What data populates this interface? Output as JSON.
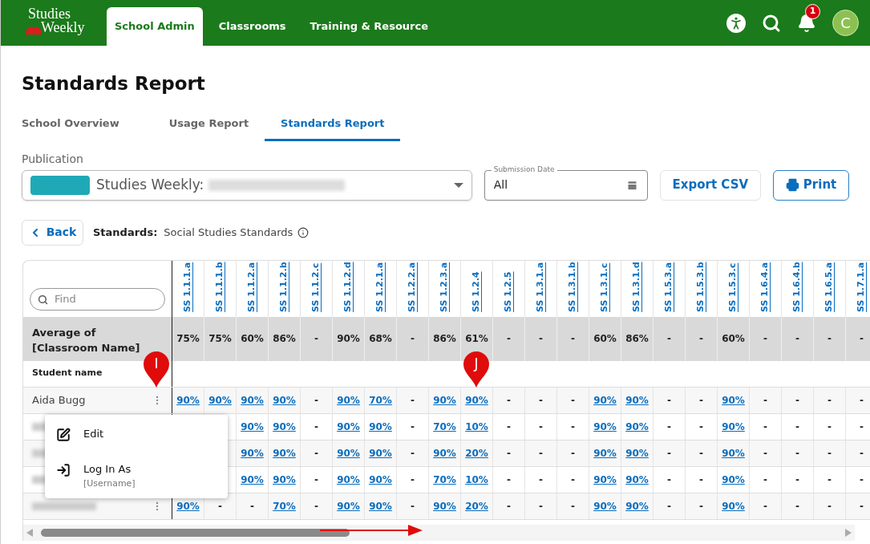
{
  "nav": {
    "logo": [
      "Studies",
      "Weekly"
    ],
    "tabs": [
      {
        "label": "School Admin",
        "selected": true
      },
      {
        "label": "Classrooms",
        "selected": false
      },
      {
        "label": "Training & Resource",
        "selected": false
      }
    ],
    "notification_count": "1",
    "avatar": "C"
  },
  "title": "Standards Report",
  "subtabs": [
    {
      "label": "School Overview",
      "selected": false
    },
    {
      "label": "Usage Report",
      "selected": false
    },
    {
      "label": "Standards Report",
      "selected": true
    }
  ],
  "publication": {
    "label": "Publication",
    "value": "Studies Weekly:"
  },
  "submission_date": {
    "label": "Submission Date",
    "value": "All"
  },
  "buttons": {
    "export": "Export CSV",
    "print": "Print",
    "back": "Back"
  },
  "standards": {
    "label": "Standards:",
    "value": "Social Studies Standards"
  },
  "table": {
    "find_placeholder": "Find",
    "average_label": "Average of [Classroom Name]",
    "student_header": "Student name",
    "columns": [
      "SS 1.1.1.a",
      "SS 1.1.1.b",
      "SS 1.1.2.a",
      "SS 1.1.2.b",
      "SS 1.1.2.c",
      "SS 1.1.2.d",
      "SS 1.2.1.a",
      "SS 1.2.2.a",
      "SS 1.2.3.a",
      "SS 1.2.4",
      "SS 1.2.5",
      "SS 1.3.1.a",
      "SS 1.3.1.b",
      "SS 1.3.1.c",
      "SS 1.3.1.d",
      "SS 1.5.3.a",
      "SS 1.5.3.b",
      "SS 1.5.3.c",
      "SS 1.6.4.a",
      "SS 1.6.4.b",
      "SS 1.6.5.a",
      "SS 1.7.1.a"
    ],
    "averages": [
      "75%",
      "75%",
      "60%",
      "86%",
      "-",
      "90%",
      "68%",
      "-",
      "86%",
      "61%",
      "-",
      "-",
      "-",
      "60%",
      "86%",
      "-",
      "-",
      "60%",
      "-",
      "-",
      "-",
      "-"
    ],
    "rows": [
      {
        "name": "Aida Bugg",
        "cells": [
          {
            "text": "90%",
            "link": true
          },
          {
            "text": "90%",
            "link": true
          },
          {
            "text": "90%",
            "link": true
          },
          {
            "text": "90%",
            "link": true
          },
          {
            "text": "-",
            "link": false
          },
          {
            "text": "90%",
            "link": true
          },
          {
            "text": "70%",
            "link": true
          },
          {
            "text": "-",
            "link": false
          },
          {
            "text": "90%",
            "link": true
          },
          {
            "text": "90%",
            "link": true
          },
          {
            "text": "-",
            "link": false
          },
          {
            "text": "-",
            "link": false
          },
          {
            "text": "-",
            "link": false
          },
          {
            "text": "90%",
            "link": true
          },
          {
            "text": "90%",
            "link": true
          },
          {
            "text": "-",
            "link": false
          },
          {
            "text": "-",
            "link": false
          },
          {
            "text": "90%",
            "link": true
          },
          {
            "text": "-",
            "link": false
          },
          {
            "text": "-",
            "link": false
          },
          {
            "text": "-",
            "link": false
          },
          {
            "text": "-",
            "link": false
          }
        ]
      },
      {
        "cells": [
          null,
          null,
          {
            "text": "90%",
            "link": true
          },
          {
            "text": "90%",
            "link": true
          },
          {
            "text": "-",
            "link": false
          },
          {
            "text": "90%",
            "link": true
          },
          {
            "text": "90%",
            "link": true
          },
          {
            "text": "-",
            "link": false
          },
          {
            "text": "70%",
            "link": true
          },
          {
            "text": "10%",
            "link": true
          },
          {
            "text": "-",
            "link": false
          },
          {
            "text": "-",
            "link": false
          },
          {
            "text": "-",
            "link": false
          },
          {
            "text": "90%",
            "link": true
          },
          {
            "text": "90%",
            "link": true
          },
          {
            "text": "-",
            "link": false
          },
          {
            "text": "-",
            "link": false
          },
          {
            "text": "90%",
            "link": true
          },
          {
            "text": "-",
            "link": false
          },
          {
            "text": "-",
            "link": false
          },
          {
            "text": "-",
            "link": false
          },
          {
            "text": "-",
            "link": false
          }
        ]
      },
      {
        "cells": [
          null,
          null,
          {
            "text": "90%",
            "link": true
          },
          {
            "text": "90%",
            "link": true
          },
          {
            "text": "-",
            "link": false
          },
          {
            "text": "90%",
            "link": true
          },
          {
            "text": "90%",
            "link": true
          },
          {
            "text": "-",
            "link": false
          },
          {
            "text": "90%",
            "link": true
          },
          {
            "text": "20%",
            "link": true
          },
          {
            "text": "-",
            "link": false
          },
          {
            "text": "-",
            "link": false
          },
          {
            "text": "-",
            "link": false
          },
          {
            "text": "90%",
            "link": true
          },
          {
            "text": "90%",
            "link": true
          },
          {
            "text": "-",
            "link": false
          },
          {
            "text": "-",
            "link": false
          },
          {
            "text": "90%",
            "link": true
          },
          {
            "text": "-",
            "link": false
          },
          {
            "text": "-",
            "link": false
          },
          {
            "text": "-",
            "link": false
          },
          {
            "text": "-",
            "link": false
          }
        ]
      },
      {
        "cells": [
          null,
          null,
          {
            "text": "90%",
            "link": true
          },
          {
            "text": "90%",
            "link": true
          },
          {
            "text": "-",
            "link": false
          },
          {
            "text": "90%",
            "link": true
          },
          {
            "text": "90%",
            "link": true
          },
          {
            "text": "-",
            "link": false
          },
          {
            "text": "70%",
            "link": true
          },
          {
            "text": "10%",
            "link": true
          },
          {
            "text": "-",
            "link": false
          },
          {
            "text": "-",
            "link": false
          },
          {
            "text": "-",
            "link": false
          },
          {
            "text": "90%",
            "link": true
          },
          {
            "text": "90%",
            "link": true
          },
          {
            "text": "-",
            "link": false
          },
          {
            "text": "-",
            "link": false
          },
          {
            "text": "90%",
            "link": true
          },
          {
            "text": "-",
            "link": false
          },
          {
            "text": "-",
            "link": false
          },
          {
            "text": "-",
            "link": false
          },
          {
            "text": "-",
            "link": false
          }
        ]
      },
      {
        "cells": [
          {
            "text": "90%",
            "link": true
          },
          {
            "text": "-",
            "link": false
          },
          {
            "text": "-",
            "link": false
          },
          {
            "text": "70%",
            "link": true
          },
          {
            "text": "-",
            "link": false
          },
          {
            "text": "90%",
            "link": true
          },
          {
            "text": "90%",
            "link": true
          },
          {
            "text": "-",
            "link": false
          },
          {
            "text": "90%",
            "link": true
          },
          {
            "text": "20%",
            "link": true
          },
          {
            "text": "-",
            "link": false
          },
          {
            "text": "-",
            "link": false
          },
          {
            "text": "-",
            "link": false
          },
          {
            "text": "90%",
            "link": true
          },
          {
            "text": "90%",
            "link": true
          },
          {
            "text": "-",
            "link": false
          },
          {
            "text": "-",
            "link": false
          },
          {
            "text": "90%",
            "link": true
          },
          {
            "text": "-",
            "link": false
          },
          {
            "text": "-",
            "link": false
          },
          {
            "text": "-",
            "link": false
          },
          {
            "text": "-",
            "link": false
          }
        ]
      }
    ]
  },
  "row_menu": {
    "items": [
      {
        "kind": "edit",
        "label": "Edit"
      },
      {
        "kind": "login",
        "label": "Log In As",
        "sublabel": "[Username]"
      }
    ]
  },
  "annotations": [
    {
      "label": "I"
    },
    {
      "label": "J"
    }
  ]
}
